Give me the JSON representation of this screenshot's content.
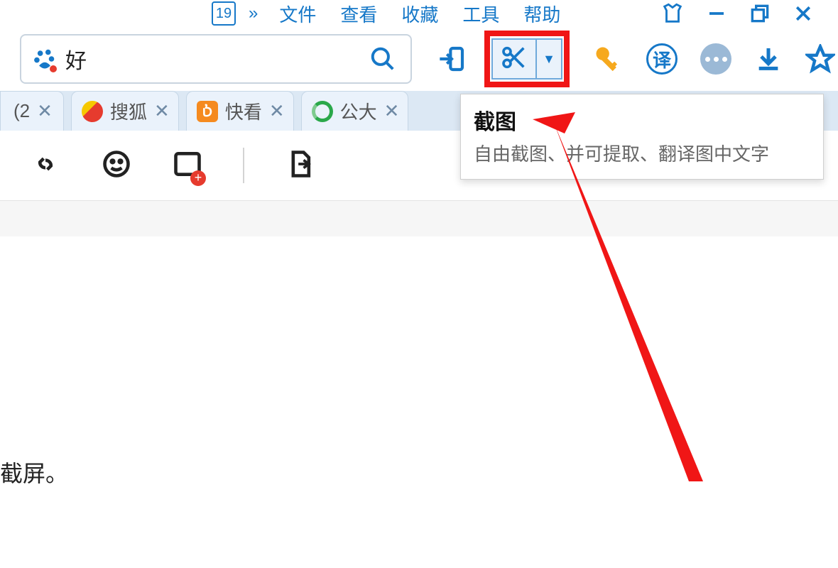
{
  "menubar": {
    "date_badge": "19",
    "chevrons": "»",
    "items": [
      "文件",
      "查看",
      "收藏",
      "工具",
      "帮助"
    ]
  },
  "search": {
    "value": "好"
  },
  "tooltip": {
    "title": "截图",
    "desc": "自由截图、并可提取、翻译图中文字"
  },
  "toolbar": {
    "translate_label": "译"
  },
  "tabs": [
    {
      "label": "(2"
    },
    {
      "label": "搜狐"
    },
    {
      "label": "快看"
    },
    {
      "label": "公大"
    }
  ],
  "content": {
    "bottom_text": "截屏。"
  }
}
